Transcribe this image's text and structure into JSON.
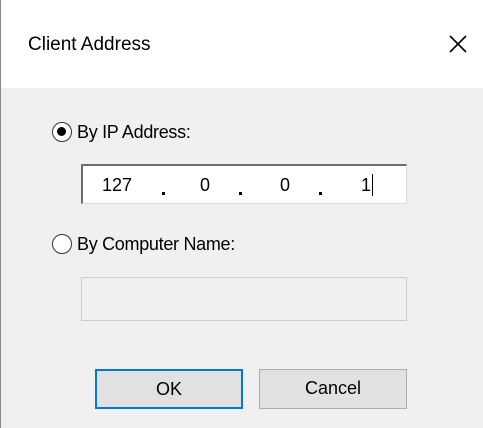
{
  "dialog": {
    "title": "Client Address",
    "close_icon": "close-icon"
  },
  "by_ip": {
    "label": "By IP Address:",
    "selected": true,
    "octets": [
      "127",
      "0",
      "0",
      "1"
    ]
  },
  "by_name": {
    "label": "By Computer Name:",
    "selected": false,
    "value": ""
  },
  "buttons": {
    "ok_label": "OK",
    "cancel_label": "Cancel"
  },
  "colors": {
    "dialog_bg": "#f0f0f0",
    "titlebar_bg": "#ffffff",
    "default_button_border": "#0078d7",
    "button_bg": "#e1e1e1"
  }
}
